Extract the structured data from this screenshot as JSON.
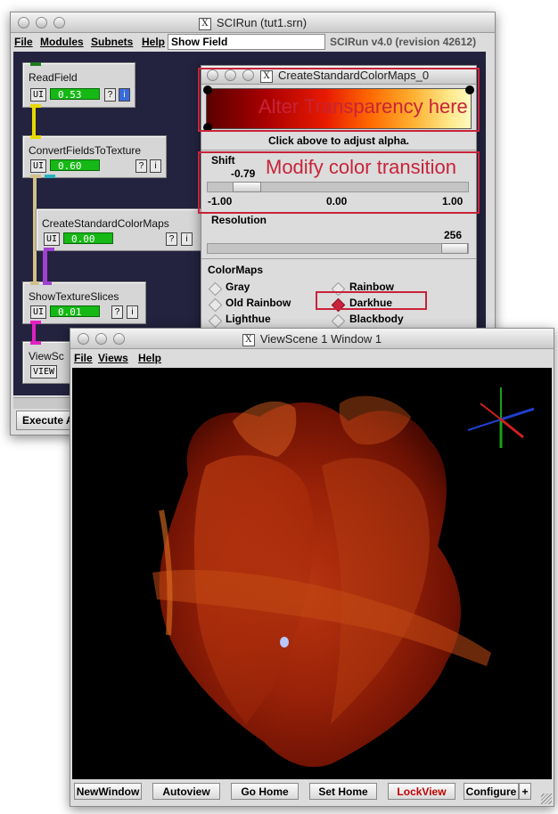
{
  "scirun": {
    "title": "SCIRun (tut1.srn)",
    "menu": [
      "File",
      "Modules",
      "Subnets",
      "Help"
    ],
    "field_value": "Show Field",
    "version": "SCIRun v4.0 (revision 42612)",
    "execute_label": "Execute A"
  },
  "modules": [
    {
      "name": "ReadField",
      "ui": "UI",
      "progress": "0.53",
      "help": "?",
      "info": "i"
    },
    {
      "name": "ConvertFieldsToTexture",
      "ui": "UI",
      "progress": "0.60",
      "help": "?",
      "info": "i"
    },
    {
      "name": "CreateStandardColorMaps",
      "ui": "UI",
      "progress": "0.00",
      "help": "?",
      "info": "i"
    },
    {
      "name": "ShowTextureSlices",
      "ui": "UI",
      "progress": "0.01",
      "help": "?",
      "info": "i"
    },
    {
      "name": "ViewSc",
      "view": "VIEW"
    }
  ],
  "colormap_dialog": {
    "title": "CreateStandardColorMaps_0",
    "alpha_hint": "Click above to adjust alpha.",
    "shift_label": "Shift",
    "shift_value": "-0.79",
    "shift_min": "-1.00",
    "shift_mid": "0.00",
    "shift_max": "1.00",
    "resolution_label": "Resolution",
    "resolution_value": "256",
    "colormaps_label": "ColorMaps",
    "options": [
      "Gray",
      "Rainbow",
      "Old Rainbow",
      "Darkhue",
      "Lighthue",
      "Blackbody"
    ],
    "selected": "Darkhue"
  },
  "annotations": {
    "transparency": "Alter Transparency here",
    "color_transition": "Modify color transition"
  },
  "viewscene": {
    "title": "ViewScene 1 Window 1",
    "menu": [
      "File",
      "Views",
      "Help"
    ],
    "buttons": [
      "NewWindow",
      "Autoview",
      "Go Home",
      "Set Home",
      "LockView",
      "Configure",
      "+"
    ]
  },
  "colors": {
    "annotation_red": "#c8233a",
    "network_bg": "#23233f",
    "progress_green": "#16b816",
    "lockview_red": "#c00000"
  }
}
